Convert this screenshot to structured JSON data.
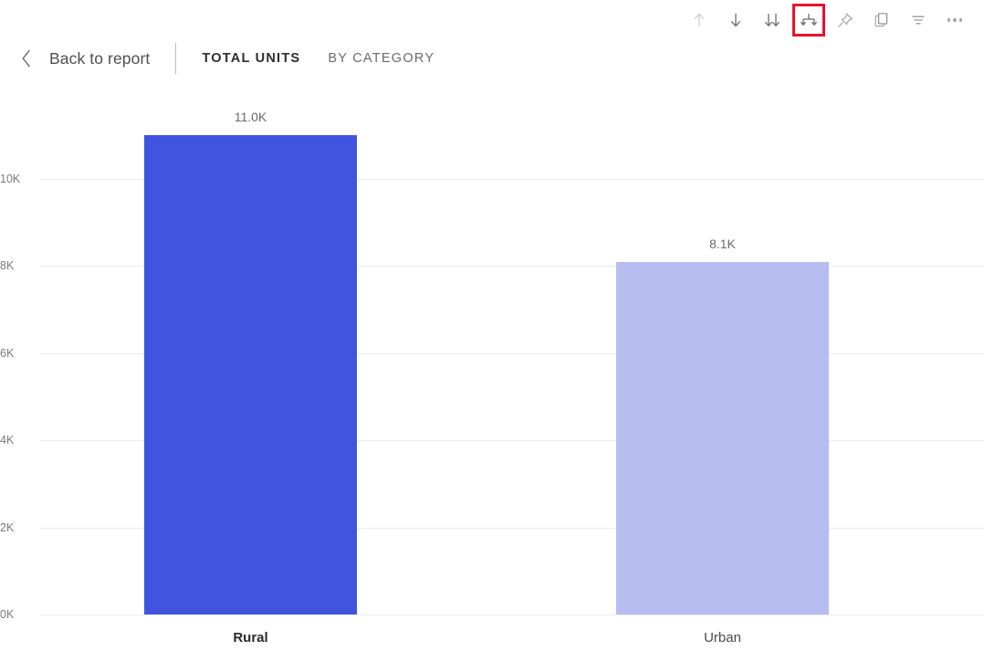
{
  "toolbar": {
    "buttons": [
      {
        "name": "drill-up-button",
        "icon": "arrow-up-icon",
        "label": "Drill up",
        "disabled": true,
        "highlighted": false
      },
      {
        "name": "drill-down-toggle-button",
        "icon": "arrow-down-icon",
        "label": "Click to turn on Drill Down",
        "disabled": false,
        "highlighted": false
      },
      {
        "name": "expand-next-level-button",
        "icon": "double-arrow-down-icon",
        "label": "Go to the next level in the hierarchy",
        "disabled": false,
        "highlighted": false
      },
      {
        "name": "expand-all-down-button",
        "icon": "drill-fork-down-icon",
        "label": "Expand all down one level in the hierarchy",
        "disabled": false,
        "highlighted": true
      },
      {
        "name": "pin-visual-button",
        "icon": "pin-icon",
        "label": "Pin visual",
        "disabled": false,
        "highlighted": false
      },
      {
        "name": "copy-visual-button",
        "icon": "copy-icon",
        "label": "Copy visual",
        "disabled": false,
        "highlighted": false
      },
      {
        "name": "filters-button",
        "icon": "filter-icon",
        "label": "Filters",
        "disabled": false,
        "highlighted": false
      },
      {
        "name": "more-options-button",
        "icon": "ellipsis-icon",
        "label": "More options",
        "disabled": false,
        "highlighted": false
      }
    ]
  },
  "header": {
    "back_label": "Back to report",
    "measure_title": "TOTAL UNITS",
    "dimension_title": "BY CATEGORY"
  },
  "colors": {
    "bar_selected": "#4054df",
    "bar_unselected": "#b5bdf1",
    "highlight_box": "#e8112d",
    "gridline": "#eceaea",
    "axis_text": "#7b7a79"
  },
  "chart_data": {
    "type": "bar",
    "title": "TOTAL UNITS BY CATEGORY",
    "xlabel": "",
    "ylabel": "",
    "categories": [
      "Rural",
      "Urban"
    ],
    "values": [
      11000,
      8100
    ],
    "data_labels": [
      "11.0K",
      "8.1K"
    ],
    "ylim": [
      0,
      11500
    ],
    "yticks": [
      0,
      2000,
      4000,
      6000,
      8000,
      10000
    ],
    "ytick_labels": [
      "0K",
      "2K",
      "4K",
      "6K",
      "8K",
      "10K"
    ],
    "grid": true,
    "legend": "none",
    "selected_category": "Rural",
    "bar_colors": [
      "#4054df",
      "#b5bdf1"
    ]
  }
}
